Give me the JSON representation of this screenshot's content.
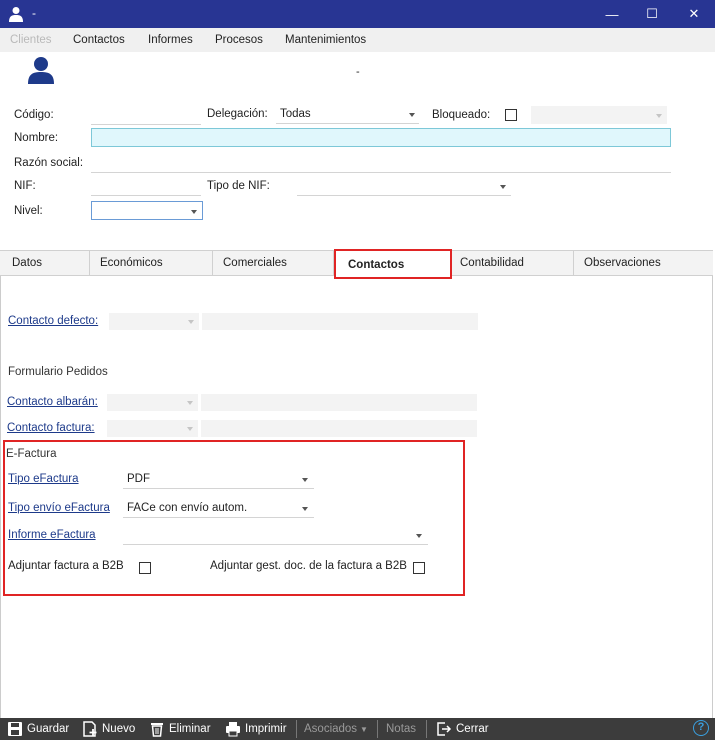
{
  "window": {
    "title": "-",
    "minimize": "—",
    "maximize": "☐",
    "close": "✕"
  },
  "menu": [
    "Clientes",
    "Contactos",
    "Informes",
    "Procesos",
    "Mantenimientos"
  ],
  "header": {
    "subtitle": "-"
  },
  "form": {
    "codigo_label": "Código:",
    "delegacion_label": "Delegación:",
    "delegacion_value": "Todas",
    "bloqueado_label": "Bloqueado:",
    "nombre_label": "Nombre:",
    "razon_label": "Razón social:",
    "nif_label": "NIF:",
    "tipo_nif_label": "Tipo de NIF:",
    "nivel_label": "Nivel:"
  },
  "tabs": [
    "Datos",
    "Económicos",
    "Comerciales",
    "Contactos",
    "Contabilidad",
    "Observaciones"
  ],
  "active_tab": "Contactos",
  "contactos": {
    "contacto_defecto": "Contacto defecto:",
    "formulario_pedidos": "Formulario Pedidos",
    "contacto_albaran": "Contacto albarán:",
    "contacto_factura": "Contacto factura:"
  },
  "efactura": {
    "title": "E-Factura",
    "tipo_label": "Tipo eFactura",
    "tipo_value": "PDF",
    "envio_label": "Tipo envío eFactura",
    "envio_value": "FACe con envío autom.",
    "informe_label": "Informe eFactura",
    "adjuntar_b2b": "Adjuntar factura a B2B",
    "adjuntar_gest": "Adjuntar gest. doc. de la factura a B2B"
  },
  "toolbar": {
    "guardar": "Guardar",
    "nuevo": "Nuevo",
    "eliminar": "Eliminar",
    "imprimir": "Imprimir",
    "asociados": "Asociados",
    "notas": "Notas",
    "cerrar": "Cerrar",
    "help": "?"
  },
  "colors": {
    "titlebar": "#283593",
    "highlight": "#e02424",
    "link": "#1d3a8a",
    "nombre_bg": "#e0f7fc"
  }
}
